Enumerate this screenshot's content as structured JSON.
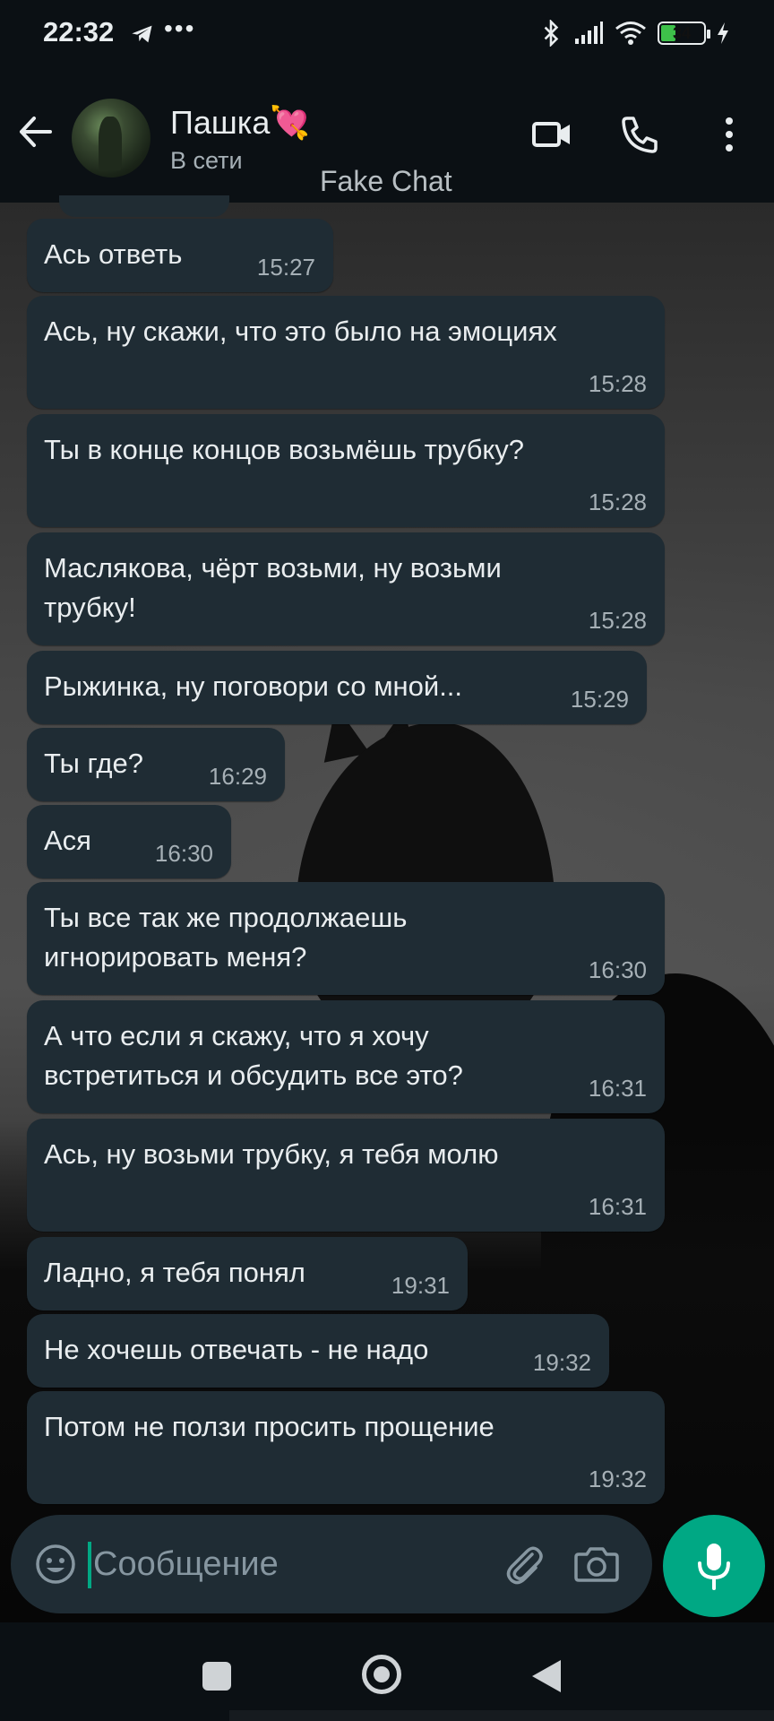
{
  "status_bar": {
    "time": "22:32",
    "dots": "•••",
    "battery": "34"
  },
  "header": {
    "contact_name": "Пашка",
    "contact_emoji": "💘",
    "status": "В сети",
    "watermark": "Fake Chat"
  },
  "messages": [
    {
      "text": "Ась ответь",
      "time": "15:27"
    },
    {
      "text": "Ась, ну скажи, что это было на эмоциях",
      "time": "15:28"
    },
    {
      "text": "Ты в конце концов возьмёшь трубку?",
      "time": "15:28"
    },
    {
      "text": "Маслякова, чёрт возьми, ну возьми\nтрубку!",
      "time": "15:28"
    },
    {
      "text": "Рыжинка, ну поговори со мной...",
      "time": "15:29"
    },
    {
      "text": "Ты где?",
      "time": "16:29"
    },
    {
      "text": "Ася",
      "time": "16:30"
    },
    {
      "text": "Ты все так же продолжаешь\nигнорировать меня?",
      "time": "16:30"
    },
    {
      "text": "А что если я скажу, что я хочу\nвстретиться и обсудить все это?",
      "time": "16:31"
    },
    {
      "text": "Ась, ну возьми трубку, я тебя молю",
      "time": "16:31"
    },
    {
      "text": "Ладно, я тебя понял",
      "time": "19:31"
    },
    {
      "text": "Не хочешь отвечать - не надо",
      "time": "19:32"
    },
    {
      "text": "Потом не ползи просить прощение",
      "time": "19:32"
    }
  ],
  "input": {
    "placeholder": "Сообщение"
  },
  "colors": {
    "accent": "#00a884",
    "bubble": "#1f2c34",
    "header_bg": "#0b1014"
  }
}
